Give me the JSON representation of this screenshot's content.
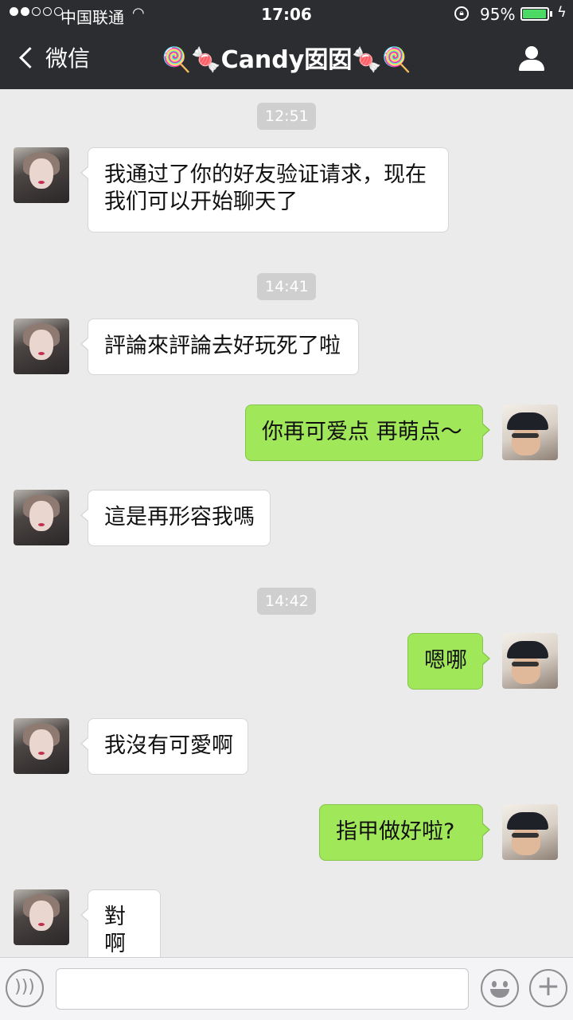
{
  "status_bar": {
    "carrier": "中国联通",
    "time": "17:06",
    "battery_percent": "95%",
    "battery_level": 0.95,
    "signal_bars": 2
  },
  "nav": {
    "back_label": "微信",
    "title": "🍭🍬Candy囡囡🍬🍭"
  },
  "messages": [
    {
      "type": "time",
      "text": "12:51"
    },
    {
      "type": "in",
      "text": "我通过了你的好友验证请求，现在我们可以开始聊天了"
    },
    {
      "type": "time",
      "text": "14:41"
    },
    {
      "type": "in",
      "text": "評論來評論去好玩死了啦"
    },
    {
      "type": "out",
      "text": "你再可爱点 再萌点～"
    },
    {
      "type": "in",
      "text": "這是再形容我嗎"
    },
    {
      "type": "time",
      "text": "14:42"
    },
    {
      "type": "out",
      "text": "嗯哪"
    },
    {
      "type": "in",
      "text": "我沒有可愛啊"
    },
    {
      "type": "out",
      "text": "指甲做好啦?"
    },
    {
      "type": "in",
      "text": "對啊"
    }
  ],
  "input": {
    "value": "",
    "placeholder": ""
  },
  "colors": {
    "nav_bg": "#2c2d31",
    "outgoing_bubble": "#a0e75a",
    "incoming_bubble": "#ffffff",
    "chat_bg": "#ebebeb"
  },
  "icons": [
    "back-chevron-icon",
    "contact-profile-icon",
    "voice-icon",
    "emoji-icon",
    "plus-icon",
    "wifi-icon",
    "lock-rotation-icon",
    "charging-bolt-icon"
  ]
}
